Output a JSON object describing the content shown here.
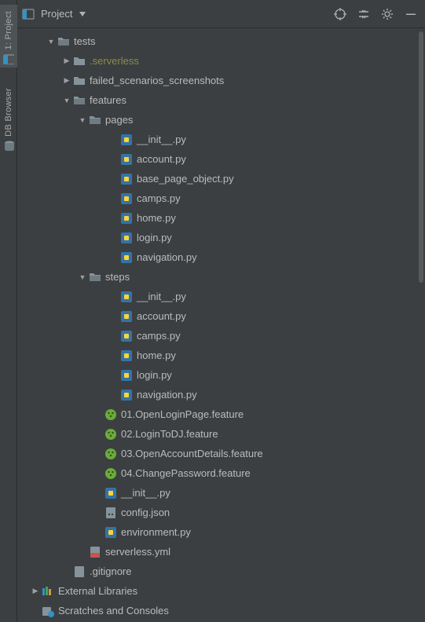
{
  "toolbar": {
    "title": "Project"
  },
  "gutter": {
    "items": [
      {
        "label": "1: Project"
      },
      {
        "label": "DB Browser"
      }
    ]
  },
  "tree": {
    "tests": "tests",
    "serverless_dir": ".serverless",
    "failed_dir": "failed_scenarios_screenshots",
    "features": "features",
    "pages": "pages",
    "pages_files": [
      "__init__.py",
      "account.py",
      "base_page_object.py",
      "camps.py",
      "home.py",
      "login.py",
      "navigation.py"
    ],
    "steps": "steps",
    "steps_files": [
      "__init__.py",
      "account.py",
      "camps.py",
      "home.py",
      "login.py",
      "navigation.py"
    ],
    "feature_files": [
      "01.OpenLoginPage.feature",
      "02.LoginToDJ.feature",
      "03.OpenAccountDetails.feature",
      "04.ChangePassword.feature"
    ],
    "init_py": "__init__.py",
    "config_json": "config.json",
    "environment_py": "environment.py",
    "serverless_yml": "serverless.yml",
    "gitignore": ".gitignore",
    "ext_lib": "External Libraries",
    "scratches": "Scratches and Consoles"
  }
}
